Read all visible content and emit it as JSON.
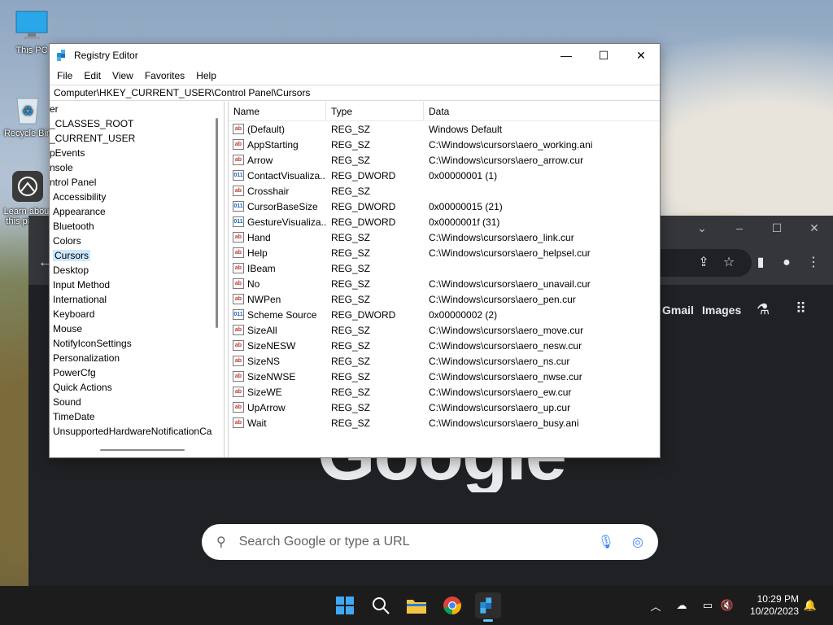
{
  "desktop": {
    "icons": [
      {
        "label": "This PC"
      },
      {
        "label": "Recycle Bin"
      },
      {
        "label": "Learn about this picture"
      }
    ]
  },
  "chrome": {
    "gmail": "Gmail",
    "images": "Images",
    "logo_text": "Google",
    "search_placeholder": "Search Google or type a URL"
  },
  "regedit": {
    "title": "Registry Editor",
    "menu": [
      "File",
      "Edit",
      "View",
      "Favorites",
      "Help"
    ],
    "address": "Computer\\HKEY_CURRENT_USER\\Control Panel\\Cursors",
    "tree": [
      {
        "label": "er",
        "indent": 0
      },
      {
        "label": "_CLASSES_ROOT",
        "indent": 0
      },
      {
        "label": "_CURRENT_USER",
        "indent": 0
      },
      {
        "label": "pEvents",
        "indent": 0
      },
      {
        "label": "nsole",
        "indent": 0
      },
      {
        "label": "ntrol Panel",
        "indent": 0
      },
      {
        "label": "Accessibility",
        "indent": 1
      },
      {
        "label": "Appearance",
        "indent": 1
      },
      {
        "label": "Bluetooth",
        "indent": 1
      },
      {
        "label": "Colors",
        "indent": 1
      },
      {
        "label": "Cursors",
        "indent": 1,
        "selected": true
      },
      {
        "label": "Desktop",
        "indent": 1
      },
      {
        "label": "Input Method",
        "indent": 1
      },
      {
        "label": "International",
        "indent": 1
      },
      {
        "label": "Keyboard",
        "indent": 1
      },
      {
        "label": "Mouse",
        "indent": 1
      },
      {
        "label": "NotifyIconSettings",
        "indent": 1
      },
      {
        "label": "Personalization",
        "indent": 1
      },
      {
        "label": "PowerCfg",
        "indent": 1
      },
      {
        "label": "Quick Actions",
        "indent": 1
      },
      {
        "label": "Sound",
        "indent": 1
      },
      {
        "label": "TimeDate",
        "indent": 1
      },
      {
        "label": "UnsupportedHardwareNotificationCa",
        "indent": 1
      }
    ],
    "columns": [
      "Name",
      "Type",
      "Data"
    ],
    "values": [
      {
        "name": "(Default)",
        "type": "REG_SZ",
        "data": "Windows Default",
        "kind": "sz"
      },
      {
        "name": "AppStarting",
        "type": "REG_SZ",
        "data": "C:\\Windows\\cursors\\aero_working.ani",
        "kind": "sz"
      },
      {
        "name": "Arrow",
        "type": "REG_SZ",
        "data": "C:\\Windows\\cursors\\aero_arrow.cur",
        "kind": "sz"
      },
      {
        "name": "ContactVisualiza...",
        "type": "REG_DWORD",
        "data": "0x00000001 (1)",
        "kind": "dword"
      },
      {
        "name": "Crosshair",
        "type": "REG_SZ",
        "data": "",
        "kind": "sz"
      },
      {
        "name": "CursorBaseSize",
        "type": "REG_DWORD",
        "data": "0x00000015 (21)",
        "kind": "dword"
      },
      {
        "name": "GestureVisualiza...",
        "type": "REG_DWORD",
        "data": "0x0000001f (31)",
        "kind": "dword"
      },
      {
        "name": "Hand",
        "type": "REG_SZ",
        "data": "C:\\Windows\\cursors\\aero_link.cur",
        "kind": "sz"
      },
      {
        "name": "Help",
        "type": "REG_SZ",
        "data": "C:\\Windows\\cursors\\aero_helpsel.cur",
        "kind": "sz"
      },
      {
        "name": "IBeam",
        "type": "REG_SZ",
        "data": "",
        "kind": "sz"
      },
      {
        "name": "No",
        "type": "REG_SZ",
        "data": "C:\\Windows\\cursors\\aero_unavail.cur",
        "kind": "sz"
      },
      {
        "name": "NWPen",
        "type": "REG_SZ",
        "data": "C:\\Windows\\cursors\\aero_pen.cur",
        "kind": "sz"
      },
      {
        "name": "Scheme Source",
        "type": "REG_DWORD",
        "data": "0x00000002 (2)",
        "kind": "dword"
      },
      {
        "name": "SizeAll",
        "type": "REG_SZ",
        "data": "C:\\Windows\\cursors\\aero_move.cur",
        "kind": "sz"
      },
      {
        "name": "SizeNESW",
        "type": "REG_SZ",
        "data": "C:\\Windows\\cursors\\aero_nesw.cur",
        "kind": "sz"
      },
      {
        "name": "SizeNS",
        "type": "REG_SZ",
        "data": "C:\\Windows\\cursors\\aero_ns.cur",
        "kind": "sz"
      },
      {
        "name": "SizeNWSE",
        "type": "REG_SZ",
        "data": "C:\\Windows\\cursors\\aero_nwse.cur",
        "kind": "sz"
      },
      {
        "name": "SizeWE",
        "type": "REG_SZ",
        "data": "C:\\Windows\\cursors\\aero_ew.cur",
        "kind": "sz"
      },
      {
        "name": "UpArrow",
        "type": "REG_SZ",
        "data": "C:\\Windows\\cursors\\aero_up.cur",
        "kind": "sz"
      },
      {
        "name": "Wait",
        "type": "REG_SZ",
        "data": "C:\\Windows\\cursors\\aero_busy.ani",
        "kind": "sz"
      }
    ],
    "icon_text": {
      "sz": "ab",
      "dword": "011"
    }
  },
  "taskbar": {
    "time": "10:29 PM",
    "date": "10/20/2023",
    "apps": [
      "start-icon",
      "search-icon",
      "file-explorer-icon",
      "chrome-icon",
      "regedit-icon"
    ]
  },
  "colors": {
    "selection": "#cce8ff",
    "taskbar": "#1c1c1c",
    "chrome_bg": "#202124"
  }
}
